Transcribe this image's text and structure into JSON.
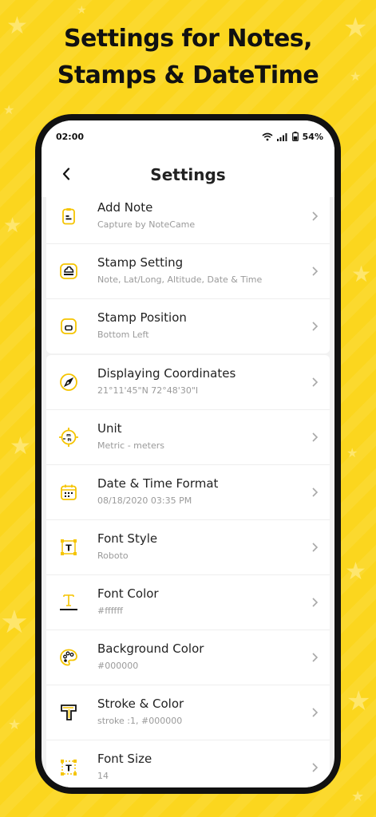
{
  "promo": {
    "line1": "Settings for Notes,",
    "line2": "Stamps & DateTime"
  },
  "status_bar": {
    "time": "02:00",
    "battery": "54%"
  },
  "header": {
    "title": "Settings"
  },
  "groups": [
    [
      {
        "icon": "note-icon",
        "title": "Add Note",
        "subtitle": "Capture by NoteCame"
      },
      {
        "icon": "stamp-icon",
        "title": "Stamp Setting",
        "subtitle": "Note, Lat/Long, Altitude, Date & Time"
      },
      {
        "icon": "stamp-position-icon",
        "title": "Stamp Position",
        "subtitle": "Bottom Left"
      }
    ],
    [
      {
        "icon": "compass-icon",
        "title": "Displaying Coordinates",
        "subtitle": "21°11'45\"N 72°48'30\"I"
      },
      {
        "icon": "unit-icon",
        "title": "Unit",
        "subtitle": "Metric - meters"
      },
      {
        "icon": "calendar-icon",
        "title": "Date & Time Format",
        "subtitle": "08/18/2020 03:35 PM"
      },
      {
        "icon": "font-style-icon",
        "title": "Font Style",
        "subtitle": "Roboto"
      },
      {
        "icon": "font-color-icon",
        "title": "Font Color",
        "subtitle": "#ffffff"
      },
      {
        "icon": "palette-icon",
        "title": "Background Color",
        "subtitle": "#000000"
      },
      {
        "icon": "stroke-icon",
        "title": "Stroke & Color",
        "subtitle": "stroke :1, #000000"
      },
      {
        "icon": "font-size-icon",
        "title": "Font Size",
        "subtitle": "14"
      }
    ]
  ],
  "colors": {
    "background": "#fbd61e",
    "accent": "#f5c400",
    "text": "#222222",
    "subtext": "#9a9a9a"
  }
}
